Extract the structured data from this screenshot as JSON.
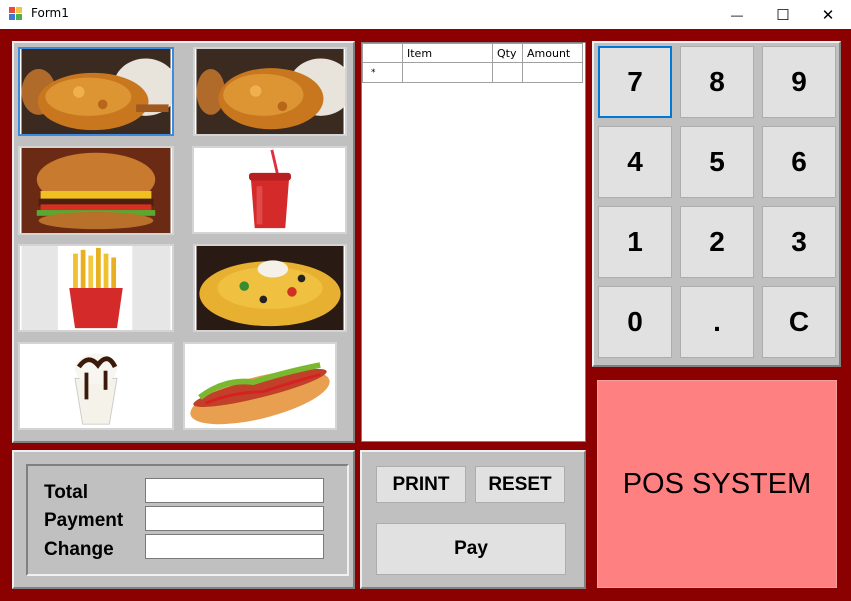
{
  "window": {
    "title": "Form1",
    "minimize_glyph": "—",
    "maximize_glyph": "☐",
    "close_glyph": "✕"
  },
  "menu_items": [
    {
      "name": "fried-chicken-1",
      "icon": "fried-chicken-icon"
    },
    {
      "name": "fried-chicken-2",
      "icon": "fried-chicken-icon"
    },
    {
      "name": "burger",
      "icon": "burger-icon"
    },
    {
      "name": "soda",
      "icon": "soda-cup-icon"
    },
    {
      "name": "fries",
      "icon": "fries-icon"
    },
    {
      "name": "nachos",
      "icon": "nachos-icon"
    },
    {
      "name": "sundae",
      "icon": "sundae-icon"
    },
    {
      "name": "hotdog",
      "icon": "hotdog-icon"
    }
  ],
  "order_grid": {
    "columns": [
      "",
      "Item",
      "Qty",
      "Amount"
    ],
    "new_row_marker": "*",
    "rows": []
  },
  "keypad": {
    "keys": [
      "7",
      "8",
      "9",
      "4",
      "5",
      "6",
      "1",
      "2",
      "3",
      "0",
      ".",
      "C"
    ]
  },
  "summary": {
    "total_label": "Total",
    "payment_label": "Payment",
    "change_label": "Change",
    "total_value": "",
    "payment_value": "",
    "change_value": ""
  },
  "actions": {
    "print_label": "PRINT",
    "reset_label": "RESET",
    "pay_label": "Pay"
  },
  "banner": {
    "text": "POS SYSTEM"
  },
  "colors": {
    "form_background": "#8b0000",
    "panel": "#c0c0c0",
    "banner": "#ff8080",
    "button": "#e1e1e1",
    "focus": "#0078d7"
  }
}
